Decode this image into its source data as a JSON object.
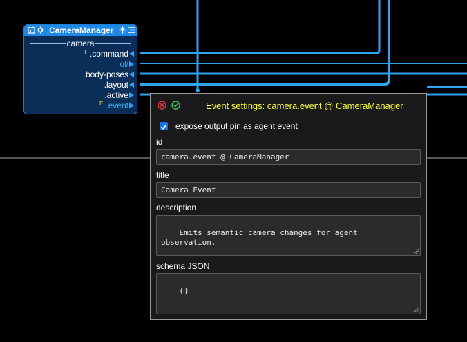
{
  "node": {
    "title": "CameraManager",
    "section": "camera",
    "icons": [
      "blueprint-icon",
      "gear-icon",
      "pin-icon",
      "list-icon"
    ],
    "pins": [
      {
        "tag": "T",
        "label": ".command",
        "dim": false
      },
      {
        "tag": "",
        "label": "ol/",
        "dim": true
      },
      {
        "tag": "",
        "label": ".body-poses",
        "dim": false
      },
      {
        "tag": "",
        "label": ".layout",
        "dim": false
      },
      {
        "tag": "",
        "label": ".active",
        "dim": false
      },
      {
        "tag": "E",
        "label": ".event",
        "dim": true
      }
    ]
  },
  "dialog": {
    "title": "Event settings: camera.event @ CameraManager",
    "expose_label": "expose output pin as agent event",
    "expose_checked": true,
    "id_label": "id",
    "id_value": "camera.event @ CameraManager",
    "title_label": "title",
    "title_value": "Camera Event",
    "description_label": "description",
    "description_value": "Emits semantic camera changes for agent\nobservation.",
    "schema_label": "schema JSON",
    "schema_value": "{}"
  },
  "colors": {
    "wire": "#2fa4f0",
    "node_header": "#1e88e5",
    "node_body": "#0a2e57",
    "dialog_title": "#ffff3a",
    "close": "#e03a3a",
    "ok": "#3cc05a"
  }
}
